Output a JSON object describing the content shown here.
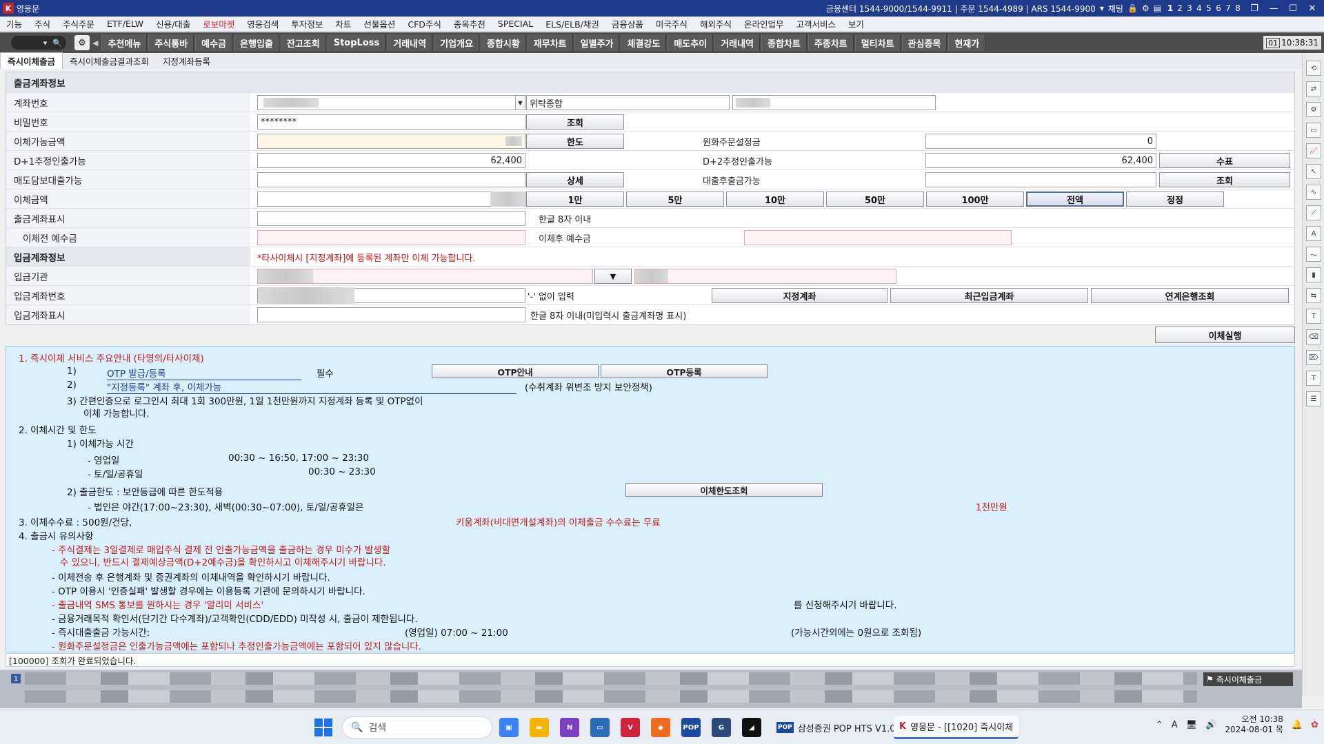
{
  "titlebar": {
    "app_name": "영웅문",
    "info": "금융센터 1544-9000/1544-9911 | 주문 1544-4989 | ARS 1544-9900",
    "chat": "채팅",
    "screen_numbers": [
      "1",
      "2",
      "3",
      "4",
      "5",
      "6",
      "7",
      "8"
    ]
  },
  "menu": [
    "기능",
    "주식",
    "주식주문",
    "ETF/ELW",
    "신용/대출",
    "로보마켓",
    "영웅검색",
    "투자정보",
    "차트",
    "선물옵션",
    "CFD주식",
    "종목추천",
    "SPECIAL",
    "ELS/ELB/채권",
    "금융상품",
    "미국주식",
    "해외주식",
    "온라인업무",
    "고객서비스",
    "보기"
  ],
  "toolbar": {
    "buttons": [
      "추천메뉴",
      "주식통바",
      "예수금",
      "은행입출",
      "잔고조회",
      "StopLoss",
      "거래내역",
      "기업개요",
      "종합시황",
      "재무차트",
      "일별주가",
      "체결강도",
      "매도추이",
      "거래내역",
      "종합차트",
      "주종차트",
      "멀티차트",
      "관심종목",
      "현재가"
    ],
    "screen_no": "01",
    "time": "10:38:31"
  },
  "tabs": [
    "즉시이체출금",
    "즉시이체출금결과조회",
    "지정계좌등록"
  ],
  "form": {
    "section_title": "출금계좌정보",
    "account_label": "계좌번호",
    "account_type": "위탁종합",
    "password_label": "비밀번호",
    "password_value": "********",
    "inquiry_btn": "조회",
    "transferable_label": "이체가능금액",
    "limit_btn": "한도",
    "won_order_label": "원화주문설정금",
    "won_order_value": "0",
    "d1_label": "D+1추정인출가능",
    "d1_value": "62,400",
    "d2_label": "D+2추정인출가능",
    "d2_value": "62,400",
    "check_btn": "수표",
    "collateral_label": "매도담보대출가능",
    "detail_btn": "상세",
    "loan_after_label": "대출후출금가능",
    "inquiry_btn2": "조회",
    "amount_label": "이체금액",
    "amount_btns": [
      "1만",
      "5만",
      "10만",
      "50만",
      "100만",
      "전액",
      "정정"
    ],
    "display_label": "출금계좌표시",
    "display_hint": "한글 8자 이내",
    "before_label": "이체전 예수금",
    "after_label": "이체후 예수금",
    "deposit_section": "입금계좌정보",
    "deposit_notice": "*타사이체시 [지정계좌]에 등록된 계좌만 이체 가능합니다.",
    "bank_label": "입금기관",
    "deposit_account_label": "입금계좌번호",
    "deposit_account_hint": "'-' 없이 입력",
    "designated_btn": "지정계좌",
    "recent_btn": "최근입금계좌",
    "linked_btn": "연계은행조회",
    "deposit_display_label": "입금계좌표시",
    "deposit_display_hint": "한글 8자 이내(미입력시 출금계좌명 표시)",
    "execute_btn": "이체실행"
  },
  "info": {
    "h1": "1. 즉시이체 서비스 주요안내 (타명의/타사이체)",
    "l1_num": "1)",
    "l1_link": "OTP 발급/등록",
    "l1_req": "필수",
    "otp_guide_btn": "OTP안내",
    "otp_reg_btn": "OTP등록",
    "l2_num": "2)",
    "l2_link": "\"지정등록\" 계좌 후, 이체가능",
    "l2_note": "(수취계좌 위변조 방지 보안정책)",
    "l3a": "3) 간편인증으로 로그인시 최대 1회 300만원, 1일 1천만원까지 지정계좌 등록 및 OTP없이",
    "l3b": "이체 가능합니다.",
    "h2": "2. 이체시간 및 한도",
    "t1": "1) 이체가능 시간",
    "t1a_label": "- 영업일",
    "t1a_value": "00:30 ~ 16:50, 17:00 ~ 23:30",
    "t1b_label": "- 토/일/공휴일",
    "t1b_value": "00:30 ~ 23:30",
    "t2": "2) 출금한도 : 보안등급에 따른 한도적용",
    "limit_btn": "이체한도조회",
    "t2a": "- 법인은 야간(17:00~23:30), 새벽(00:30~07:00), 토/일/공휴일은",
    "t2a_red": "1천만원",
    "h3": "3. 이체수수료 : 500원/건당,",
    "h3_red": "키움계좌(비대면개설계좌)의 이체출금 수수료는 무료",
    "h4": "4. 출금시 유의사항",
    "n1a": "- 주식결제는 3일결제로 매입주식 결제 전 인출가능금액을 출금하는 경우 미수가 발생할",
    "n1b": "수 있으니, 반드시 결제예상금액(D+2예수금)을 확인하시고 이체해주시기 바랍니다.",
    "n2": "- 이체전송 후 은행계좌 및 증권계좌의 이체내역을 확인하시기 바랍니다.",
    "n3": "- OTP 이용시 '인증실패' 발생할 경우에는 이용등록 기관에 문의하시기 바랍니다.",
    "n4": "- 출금내역 SMS 통보를 원하시는 경우 '알리미 서비스'",
    "n4b": "를 신청해주시기 바랍니다.",
    "n5": "- 금융거래목적 확인서(단기간 다수계좌)/고객확인(CDD/EDD) 미작성 시, 출금이 제한됩니다.",
    "n6": "- 즉시대출출금 가능시간:",
    "n6b": "(영업일) 07:00 ~ 21:00",
    "n6c": "(가능시간외에는 0원으로 조회됨)",
    "n7": "- 원화주문설정금은 인출가능금액에는 포함되나 추정인출가능금액에는 포함되어 있지 않습니다."
  },
  "status": "[100000] 조회가 완료되었습니다.",
  "bottom_tab": "즉시이체출금",
  "taskbar": {
    "search": "검색",
    "app1": "삼성증권 POP HTS V1.0",
    "app2": "영웅문 - [[1020] 즉시이체",
    "ampm_time": "오전 10:38",
    "date": "2024-08-01 목"
  }
}
